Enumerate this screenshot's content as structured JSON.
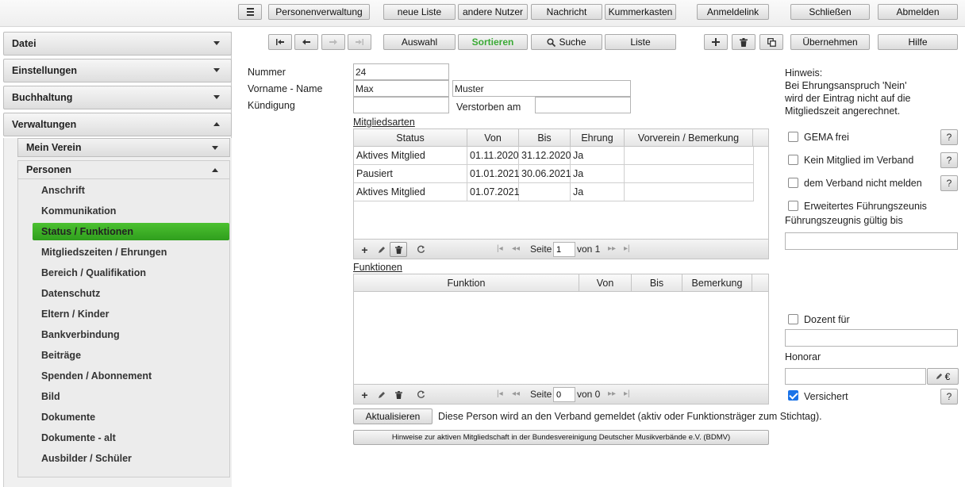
{
  "topbar": {
    "menu_icon": "list-icon",
    "buttons": [
      "Personenverwaltung",
      "neue Liste",
      "andere Nutzer",
      "Nachricht",
      "Kummerkasten",
      "Anmeldelink",
      "Schließen",
      "Abmelden"
    ]
  },
  "toolbar": {
    "nav_icons": [
      "first-record-icon",
      "arrow-left-icon",
      "arrow-right-icon",
      "last-record-icon"
    ],
    "auswahl": "Auswahl",
    "sortieren": "Sortieren",
    "suche": "Suche",
    "liste": "Liste",
    "add_icon": "plus-icon",
    "delete_icon": "trash-icon",
    "copy_icon": "copy-icon",
    "uebernehmen": "Übernehmen",
    "hilfe": "Hilfe",
    "accent_green": "#3aaa35"
  },
  "sidebar": {
    "sections": [
      "Datei",
      "Einstellungen",
      "Buchhaltung",
      "Verwaltungen"
    ],
    "sub_sections": [
      "Mein Verein",
      "Personen"
    ],
    "items": [
      "Anschrift",
      "Kommunikation",
      "Status / Funktionen",
      "Mitgliedszeiten / Ehrungen",
      "Bereich / Qualifikation",
      "Datenschutz",
      "Eltern / Kinder",
      "Bankverbindung",
      "Beiträge",
      "Spenden / Abonnement",
      "Bild",
      "Dokumente",
      "Dokumente - alt",
      "Ausbilder / Schüler"
    ],
    "active_item": "Status / Funktionen",
    "active_color": "#3fb528"
  },
  "form": {
    "nummer_label": "Nummer",
    "nummer_value": "24",
    "name_label": "Vorname - Name",
    "vorname_value": "Max",
    "nachname_value": "Muster",
    "kuendigung_label": "Kündigung",
    "kuendigung_value": "",
    "verstorben_label": "Verstorben am",
    "verstorben_value": ""
  },
  "mitgliedsarten": {
    "title": "Mitgliedsarten",
    "columns": [
      "Status",
      "Von",
      "Bis",
      "Ehrung",
      "Vorverein / Bemerkung"
    ],
    "rows": [
      [
        "Aktives Mitglied",
        "01.11.2020",
        "31.12.2020",
        "Ja",
        ""
      ],
      [
        "Pausiert",
        "01.01.2021",
        "30.06.2021",
        "Ja",
        ""
      ],
      [
        "Aktives Mitglied",
        "01.07.2021",
        "",
        "Ja",
        ""
      ]
    ],
    "footer": {
      "seite_label": "Seite",
      "page": "1",
      "von_label": "von 1"
    }
  },
  "funktionen": {
    "title": "Funktionen",
    "columns": [
      "Funktion",
      "Von",
      "Bis",
      "Bemerkung"
    ],
    "rows": [],
    "footer": {
      "seite_label": "Seite",
      "page": "0",
      "von_label": "von 0"
    }
  },
  "actions": {
    "aktualisieren": "Aktualisieren",
    "verband_info": "Diese Person wird an den Verband gemeldet (aktiv oder Funktionsträger zum Stichtag).",
    "bdmv_button": "Hinweise zur aktiven Mitgliedschaft in der Bundesvereinigung Deutscher Musikverbände e.V. (BDMV)"
  },
  "right_panel": {
    "hint_title": "Hinweis:",
    "hint_lines": [
      "Bei Ehrungsanspruch 'Nein'",
      "wird der Eintrag nicht auf die",
      "Mitgliedszeit angerechnet."
    ],
    "gema_label": "GEMA frei",
    "gema_checked": false,
    "kein_mitglied_label": "Kein Mitglied im Verband",
    "kein_mitglied_checked": false,
    "nicht_melden_label": "dem Verband nicht melden",
    "nicht_melden_checked": false,
    "fuehrungszeugnis_label": "Erweitertes Führungszeunis",
    "fuehrungszeugnis_checked": false,
    "gueltig_label": "Führungszeugnis gültig bis",
    "gueltig_value": "",
    "dozent_label": "Dozent für",
    "dozent_checked": false,
    "dozent_value": "",
    "honorar_label": "Honorar",
    "honorar_value": "",
    "honorar_button": "€",
    "versichert_label": "Versichert",
    "versichert_checked": true,
    "help_symbol": "?"
  }
}
